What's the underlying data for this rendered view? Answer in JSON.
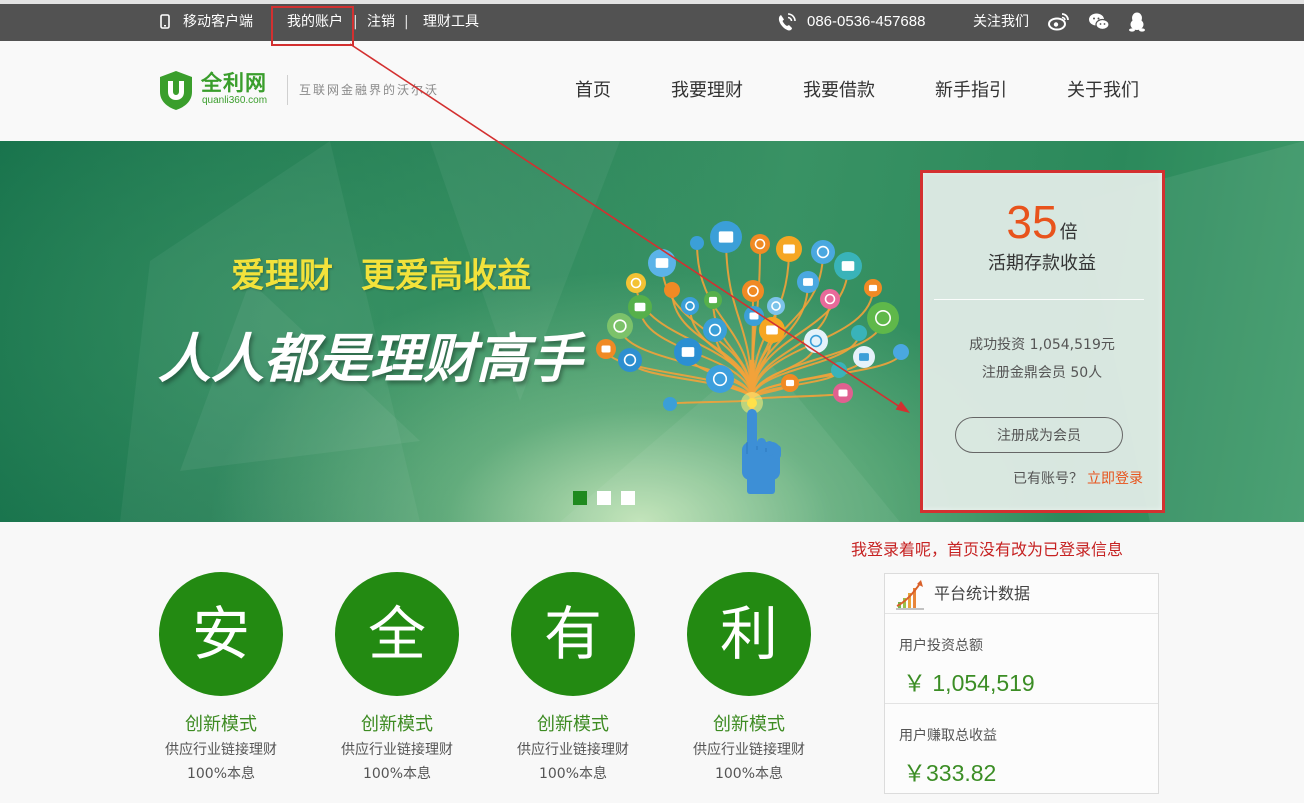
{
  "topbar": {
    "mobile_icon": "mobile-phone-icon",
    "mobile_client": "移动客户端",
    "my_account": "我的账户",
    "separator": "|",
    "logout": "注销",
    "finance_tools": "理财工具",
    "phone_icon": "phone-handset-icon",
    "phone": "086-0536-457688",
    "follow_us": "关注我们",
    "social_icons": [
      "weibo-icon",
      "wechat-icon",
      "qq-icon"
    ]
  },
  "header": {
    "logo_name": "全利网",
    "logo_domain": "quanli360.com",
    "slogan": "互联网金融界的沃尔沃",
    "nav": [
      "首页",
      "我要理财",
      "我要借款",
      "新手指引",
      "关于我们"
    ]
  },
  "banner": {
    "tagline": [
      "爱理财",
      "更爱高收益"
    ],
    "headline": "人人都是理财高手",
    "carousel": {
      "slide_count": 3,
      "active_slide": 1
    }
  },
  "promo_panel": {
    "multiplier": "35",
    "multiplier_unit": "倍",
    "product": "活期存款收益",
    "invest_label": "成功投资",
    "invest_value": "1,054,519元",
    "members_label": "注册金鼎会员",
    "members_value": "50人",
    "register_button": "注册成为会员",
    "has_account": "已有账号？",
    "login_link": "立即登录"
  },
  "annotation_note": "我登录着呢，首页没有改为已登录信息",
  "features": [
    {
      "char": "安",
      "title": "创新模式",
      "line1": "供应行业链接理财",
      "line2": "100%本息"
    },
    {
      "char": "全",
      "title": "创新模式",
      "line1": "供应行业链接理财",
      "line2": "100%本息"
    },
    {
      "char": "有",
      "title": "创新模式",
      "line1": "供应行业链接理财",
      "line2": "100%本息"
    },
    {
      "char": "利",
      "title": "创新模式",
      "line1": "供应行业链接理财",
      "line2": "100%本息"
    }
  ],
  "stats": {
    "icon": "growth-chart-icon",
    "title": "平台统计数据",
    "items": [
      {
        "label": "用户投资总额",
        "value": "￥ 1,054,519"
      },
      {
        "label": "用户赚取总收益",
        "value": "￥333.82"
      }
    ]
  },
  "colors": {
    "topbar_bg": "#525252",
    "brand_green": "#3a9e2c",
    "feature_green": "#238a12",
    "accent_orange": "#e8531c",
    "tagline_yellow": "#f2e23b",
    "annotation_red": "#d33030"
  }
}
